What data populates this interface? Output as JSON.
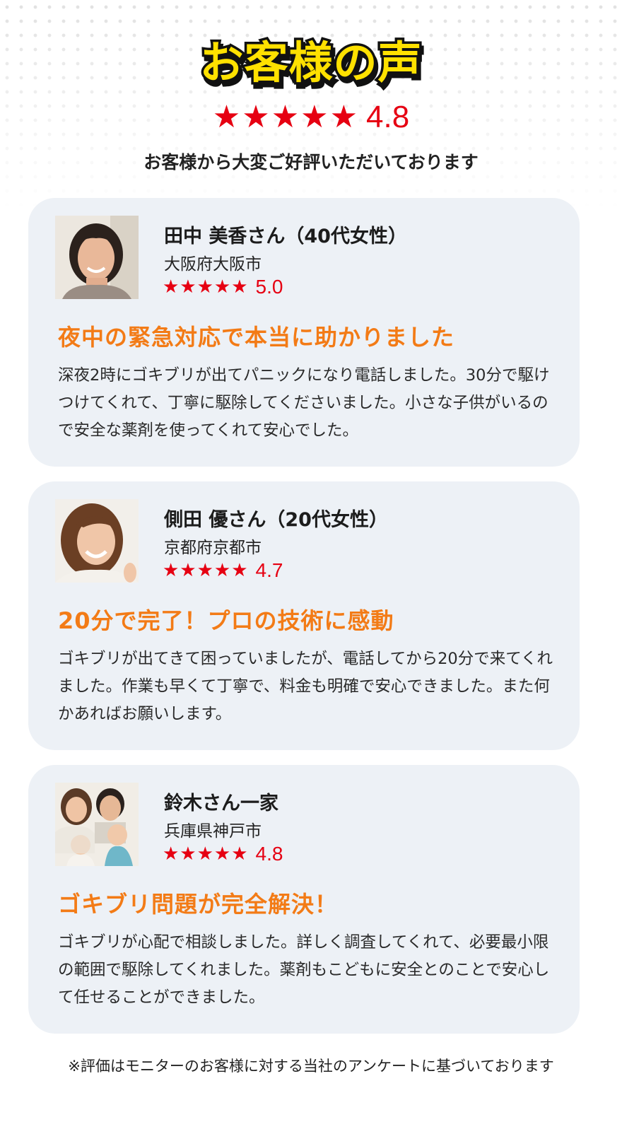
{
  "header": {
    "title": "お客様の声",
    "stars": "★★★★★",
    "rating": "4.8",
    "subtitle": "お客様から大変ご好評いただいております"
  },
  "reviews": [
    {
      "name": "田中 美香さん（40代女性）",
      "location": "大阪府大阪市",
      "stars": "★★★★★",
      "rating": "5.0",
      "headline": "夜中の緊急対応で本当に助かりました",
      "body": "深夜2時にゴキブリが出てパニックになり電話しました。30分で駆けつけてくれて、丁寧に駆除してくださいました。小さな子供がいるので安全な薬剤を使ってくれて安心でした。"
    },
    {
      "name": "側田 優さん（20代女性）",
      "location": "京都府京都市",
      "stars": "★★★★★",
      "rating": "4.7",
      "headline": "20分で完了！プロの技術に感動",
      "body": "ゴキブリが出てきて困っていましたが、電話してから20分で来てくれました。作業も早くて丁寧で、料金も明確で安心できました。また何かあればお願いします。"
    },
    {
      "name": "鈴木さん一家",
      "location": "兵庫県神戸市",
      "stars": "★★★★★",
      "rating": "4.8",
      "headline": "ゴキブリ問題が完全解決！",
      "body": "ゴキブリが心配で相談しました。詳しく調査してくれて、必要最小限の範囲で駆除してくれました。薬剤もこどもに安全とのことで安心して任せることができました。"
    }
  ],
  "footnote": "※評価はモニターのお客様に対する当社のアンケートに基づいております",
  "colors": {
    "star": "#E60012",
    "headline": "#F37B16",
    "title_fill": "#FFE100",
    "card_bg": "#EDF1F6"
  }
}
